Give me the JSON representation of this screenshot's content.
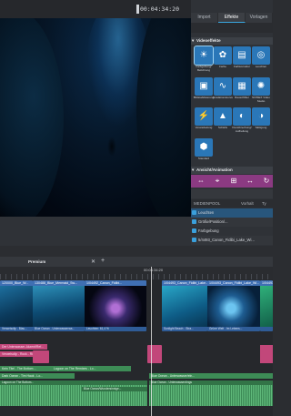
{
  "preview": {
    "timecode": "00:04:34:20"
  },
  "panel": {
    "tabs": [
      "Import",
      "Effekte",
      "Vorlagen"
    ],
    "active_tab": "Effekte",
    "section_video_effects": "Videoeffekte",
    "section_anim": "Ansicht/Animation",
    "effects": [
      {
        "label": "Farbgebung/ Belichtung",
        "icon": "sun-icon",
        "selected": true
      },
      {
        "label": "Farbe",
        "icon": "palette-icon"
      },
      {
        "label": "Farbkorrektur",
        "icon": "sliders-icon"
      },
      {
        "label": "Leuchten",
        "icon": "glow-icon"
      },
      {
        "label": "Bildstabilisierung",
        "icon": "stabilize-icon"
      },
      {
        "label": "Gradationskurve",
        "icon": "curve-icon"
      },
      {
        "label": "Rauschfilter",
        "icon": "denoise-icon"
      },
      {
        "label": "NOISEX Video Studio",
        "icon": "noise-icon"
      },
      {
        "label": "Verwackelung",
        "icon": "shake-icon"
      },
      {
        "label": "Schärfe",
        "icon": "sharpen-icon"
      },
      {
        "label": "Dunstbrechung/ Aufhellung",
        "icon": "dehaze-icon"
      },
      {
        "label": "Sättigung",
        "icon": "saturation-icon"
      },
      {
        "label": "Standard",
        "icon": "hexagon-icon"
      }
    ],
    "media_header": {
      "col1": "MEDIENPOOL",
      "col2": "Vorhalt",
      "col3": "Ty"
    },
    "media_rows": [
      "Leuchten",
      "Größe/Position/...",
      "Farbgebung",
      "5/4493_Canon_Fidibi_Lake_Wi..."
    ]
  },
  "timeline": {
    "arranger_label": "Premium",
    "ruler_time": "00:04:34:20",
    "clips": [
      {
        "title": "120000_Blue_W...",
        "footer": "Verweisclip - Blau..."
      },
      {
        "title": "130488_Blue_Mermaid_Sw...",
        "footer": "Blue Ocean - Unterwasserwa..."
      },
      {
        "title": "1/04492_Canon_Fidibi...",
        "footer": "Leuchten: 61,4 %"
      },
      {
        "title": "1/04493_Canon_Fidibi_Lake...",
        "footer": "Sunlight Beach - Stra..."
      },
      {
        "title": "1/04493_Canon_Fidibi_Lake_Wi...",
        "footer": "Grüne Welt - Im Lebens..."
      },
      {
        "title": "1/04493_C...",
        "footer": ""
      }
    ],
    "pink_bars": [
      "Der Unterwasser-Akzent/Ref...",
      "Verweisclip - Rock - Rückfin..."
    ],
    "green_bars": [
      "Kein Titel - The Bottom ...",
      "Lagoon on The Remixes - Lo...",
      "Dark Ocean - Tim Hauk - Lo...",
      "Blue Ocean - Unterwasser/eln..."
    ],
    "audio_clips": [
      "Lagoon on The Bottom...",
      "Blue Ocean/Wundersinnige...",
      "Blue Ocean - Unterwasserdings"
    ]
  }
}
